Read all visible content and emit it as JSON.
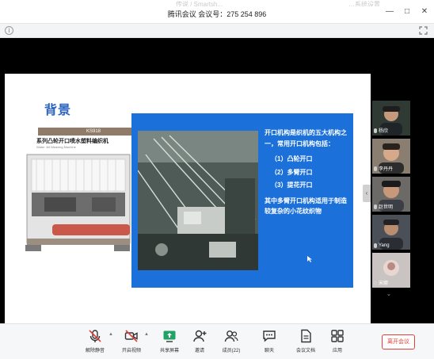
{
  "window": {
    "faded_left_text": "",
    "faded_mid_text": "传说 / Smartsh...",
    "faded_right_text": "…系统设置",
    "title": "腾讯会议 会议号：275 254 896",
    "minimize": "—",
    "maximize": "□",
    "close": "✕"
  },
  "slide": {
    "title": "背景",
    "machine_tag": "KS918",
    "machine_name": "系列凸轮开口喷水塑料编织机",
    "machine_subtitle": "Water Jet Weaving Machine",
    "paragraph_1": "开口机构是织机的五大机构之一，常用开口机构包括：",
    "item_1": "（1）凸轮开口",
    "item_2": "（2）多臂开口",
    "item_3": "（3）提花开口",
    "paragraph_2": "其中多臂开口机构适用于制造较复杂的小花纹织物"
  },
  "participants": [
    {
      "name": "杨欣",
      "bg": "#2f3a35"
    },
    {
      "name": "李丹丹",
      "bg": "#8a7e70"
    },
    {
      "name": "赵世明",
      "bg": "#6b6a66"
    },
    {
      "name": "Yang",
      "bg": "#4b4f58"
    },
    {
      "name": "宋娜",
      "bg": "#c9c4c2"
    }
  ],
  "toolbar": {
    "items": [
      {
        "label": "解除静音",
        "icon": "mic-muted-icon"
      },
      {
        "label": "开启视频",
        "icon": "camera-off-icon"
      },
      {
        "label": "共享屏幕",
        "icon": "share-screen-icon"
      },
      {
        "label": "邀请",
        "icon": "invite-user-icon"
      },
      {
        "label": "成员(22)",
        "icon": "members-icon"
      },
      {
        "label": "聊天",
        "icon": "chat-icon"
      },
      {
        "label": "会议文档",
        "icon": "document-icon"
      },
      {
        "label": "应用",
        "icon": "apps-icon"
      }
    ],
    "end_button": "离开会议"
  },
  "colors": {
    "accent_blue": "#1b70da",
    "slide_title": "#2b63c1",
    "danger": "#e0403a"
  }
}
